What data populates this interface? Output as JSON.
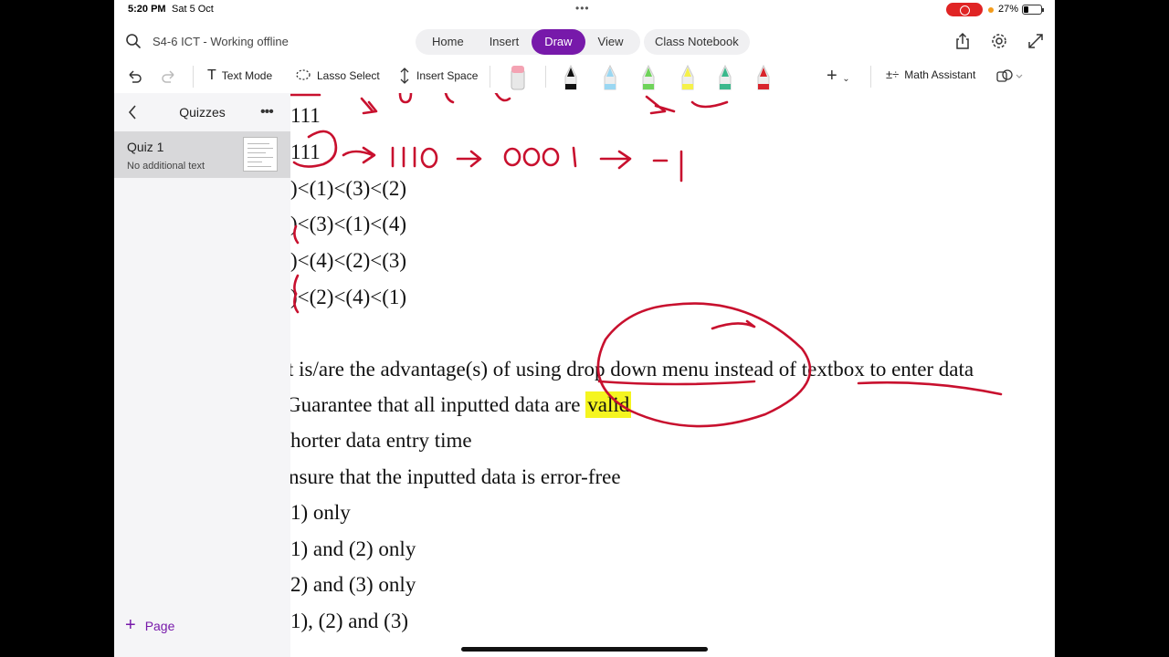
{
  "status": {
    "time": "5:20 PM",
    "date": "Sat 5 Oct",
    "battery": "27%"
  },
  "title": {
    "doc_title": "S4-6 ICT - Working offline"
  },
  "tabs": [
    {
      "label": "Home"
    },
    {
      "label": "Insert"
    },
    {
      "label": "Draw",
      "active": true
    },
    {
      "label": "View"
    }
  ],
  "class_notebook": "Class Notebook",
  "toolbar": {
    "text_mode": "Text Mode",
    "lasso_select": "Lasso Select",
    "insert_space": "Insert Space",
    "math_assistant": "Math Assistant",
    "pen_colors": [
      "#b0b0b0",
      "#111111",
      "#9ad7f2",
      "#6fd35a",
      "#f5f14a",
      "#3bb88c",
      "#d8242c"
    ]
  },
  "sidebar": {
    "section_title": "Quizzes",
    "page": {
      "title": "Quiz 1",
      "subtitle": "No additional text"
    },
    "add_page": "Page"
  },
  "content": {
    "lines": [
      "111",
      "111",
      ")<(1)<(3)<(2)",
      ")<(3)<(1)<(4)",
      ")<(4)<(2)<(3)",
      ")<(2)<(4)<(1)",
      "t is/are the advantage(s) of using drop down menu instead of textbox to enter data",
      "Guarantee that all inputted data are ",
      "valid",
      "horter data entry time",
      "nsure that the inputted data is error-free",
      "1) only",
      "1) and (2) only",
      "2) and (3) only",
      "1), (2) and (3)"
    ]
  },
  "ink": {
    "color": "#c8102e",
    "annotation": "→1110 → 0001 → -1"
  }
}
